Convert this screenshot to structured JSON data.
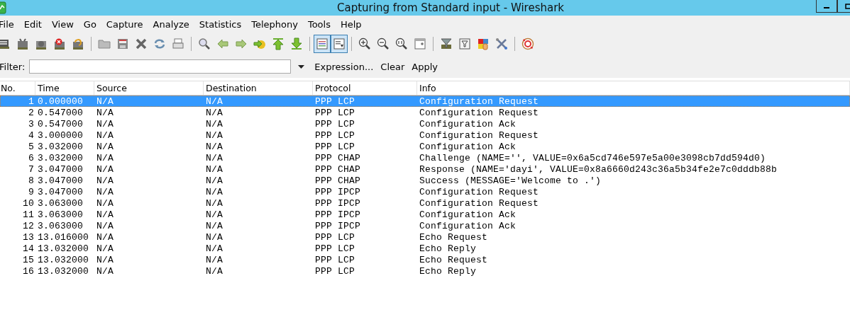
{
  "window": {
    "title": "Capturing from Standard input - Wireshark"
  },
  "menu": [
    "File",
    "Edit",
    "View",
    "Go",
    "Capture",
    "Analyze",
    "Statistics",
    "Telephony",
    "Tools",
    "Help"
  ],
  "toolbar": [
    {
      "items": [
        {
          "kind": "interfaces",
          "pressed": false
        },
        {
          "kind": "options",
          "pressed": false
        },
        {
          "kind": "start",
          "pressed": false
        },
        {
          "kind": "stop",
          "pressed": false
        },
        {
          "kind": "restart",
          "pressed": false
        }
      ]
    },
    {
      "items": [
        {
          "kind": "open",
          "pressed": false
        },
        {
          "kind": "save",
          "pressed": false
        },
        {
          "kind": "close",
          "pressed": false
        },
        {
          "kind": "reload",
          "pressed": false
        },
        {
          "kind": "print",
          "pressed": false
        }
      ]
    },
    {
      "items": [
        {
          "kind": "find",
          "pressed": false
        },
        {
          "kind": "back",
          "pressed": false
        },
        {
          "kind": "forward",
          "pressed": false
        },
        {
          "kind": "goto",
          "pressed": false
        },
        {
          "kind": "first",
          "pressed": false
        },
        {
          "kind": "last",
          "pressed": false
        }
      ]
    },
    {
      "items": [
        {
          "kind": "colorize",
          "pressed": true
        },
        {
          "kind": "autoscroll",
          "pressed": true
        }
      ]
    },
    {
      "items": [
        {
          "kind": "zoomin",
          "pressed": false
        },
        {
          "kind": "zoomout",
          "pressed": false
        },
        {
          "kind": "zoomnormal",
          "pressed": false
        },
        {
          "kind": "resize",
          "pressed": false
        }
      ]
    },
    {
      "items": [
        {
          "kind": "capfilter",
          "pressed": false
        },
        {
          "kind": "dispfilter",
          "pressed": false
        },
        {
          "kind": "coloring",
          "pressed": false
        },
        {
          "kind": "prefs",
          "pressed": false
        }
      ]
    },
    {
      "items": [
        {
          "kind": "help",
          "pressed": false
        }
      ]
    }
  ],
  "filter": {
    "label": "Filter:",
    "actions": [
      "Expression...",
      "Clear",
      "Apply"
    ]
  },
  "table": {
    "columns": [
      "No.",
      "Time",
      "Source",
      "Destination",
      "Protocol",
      "Info"
    ],
    "rows": [
      {
        "cells": [
          "1",
          "0.000000",
          "N/A",
          "N/A",
          "PPP LCP",
          "Configuration Request"
        ],
        "selected": true
      },
      {
        "cells": [
          "2",
          "0.547000",
          "N/A",
          "N/A",
          "PPP LCP",
          "Configuration Request"
        ],
        "selected": false
      },
      {
        "cells": [
          "3",
          "0.547000",
          "N/A",
          "N/A",
          "PPP LCP",
          "Configuration Ack"
        ],
        "selected": false
      },
      {
        "cells": [
          "4",
          "3.000000",
          "N/A",
          "N/A",
          "PPP LCP",
          "Configuration Request"
        ],
        "selected": false
      },
      {
        "cells": [
          "5",
          "3.032000",
          "N/A",
          "N/A",
          "PPP LCP",
          "Configuration Ack"
        ],
        "selected": false
      },
      {
        "cells": [
          "6",
          "3.032000",
          "N/A",
          "N/A",
          "PPP CHAP",
          "Challenge (NAME='', VALUE=0x6a5cd746e597e5a00e3098cb7dd594d0)"
        ],
        "selected": false
      },
      {
        "cells": [
          "7",
          "3.047000",
          "N/A",
          "N/A",
          "PPP CHAP",
          "Response (NAME='dayi', VALUE=0x8a6660d243c36a5b34fe2e7c0dddb88b"
        ],
        "selected": false
      },
      {
        "cells": [
          "8",
          "3.047000",
          "N/A",
          "N/A",
          "PPP CHAP",
          "Success (MESSAGE='Welcome to .')"
        ],
        "selected": false
      },
      {
        "cells": [
          "9",
          "3.047000",
          "N/A",
          "N/A",
          "PPP IPCP",
          "Configuration Request"
        ],
        "selected": false
      },
      {
        "cells": [
          "10",
          "3.063000",
          "N/A",
          "N/A",
          "PPP IPCP",
          "Configuration Request"
        ],
        "selected": false
      },
      {
        "cells": [
          "11",
          "3.063000",
          "N/A",
          "N/A",
          "PPP IPCP",
          "Configuration Ack"
        ],
        "selected": false
      },
      {
        "cells": [
          "12",
          "3.063000",
          "N/A",
          "N/A",
          "PPP IPCP",
          "Configuration Ack"
        ],
        "selected": false
      },
      {
        "cells": [
          "13",
          "13.016000",
          "N/A",
          "N/A",
          "PPP LCP",
          "Echo Request"
        ],
        "selected": false
      },
      {
        "cells": [
          "14",
          "13.032000",
          "N/A",
          "N/A",
          "PPP LCP",
          "Echo Reply"
        ],
        "selected": false
      },
      {
        "cells": [
          "15",
          "13.032000",
          "N/A",
          "N/A",
          "PPP LCP",
          "Echo Request"
        ],
        "selected": false
      },
      {
        "cells": [
          "16",
          "13.032000",
          "N/A",
          "N/A",
          "PPP LCP",
          "Echo Reply"
        ],
        "selected": false
      }
    ]
  }
}
